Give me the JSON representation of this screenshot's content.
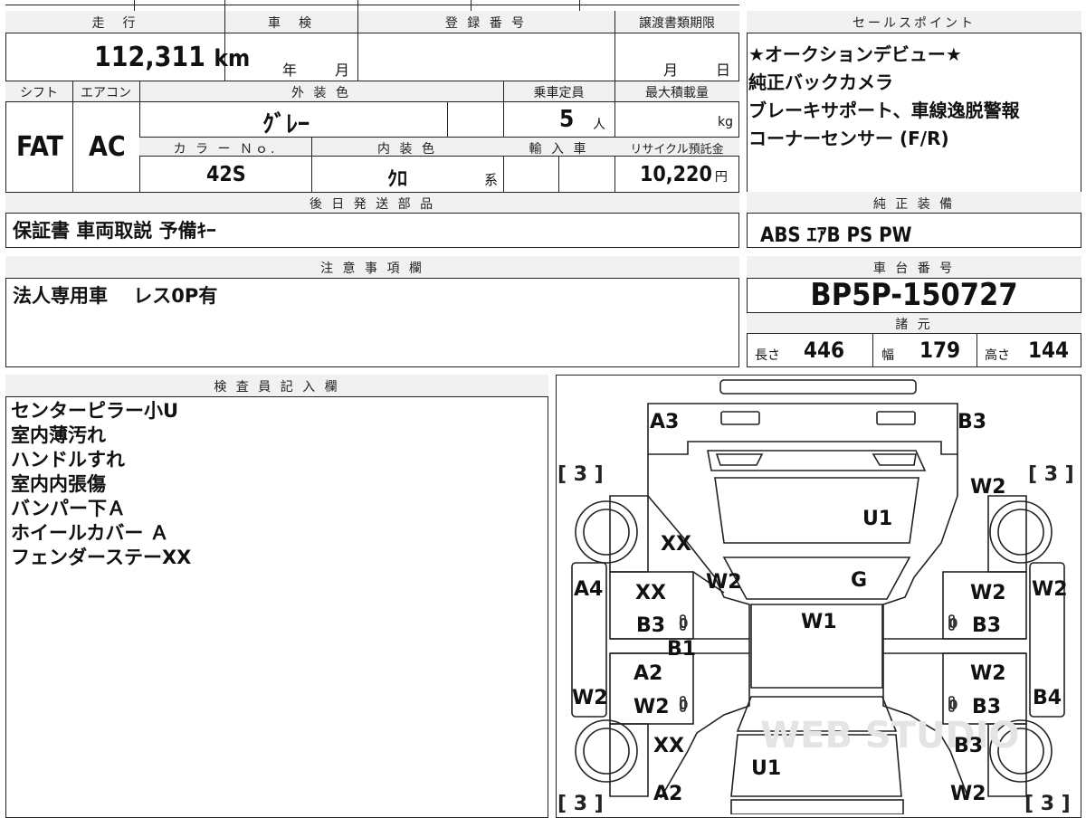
{
  "spec": {
    "mileage_label": "走　行",
    "mileage_value": "112,311",
    "mileage_unit": "km",
    "inspection_label": "車　検",
    "inspection_year": "年",
    "inspection_month": "月",
    "registration_label": "登 録 番 号",
    "registration_value": "",
    "transfer_label": "譲渡書類期限",
    "transfer_month": "月",
    "transfer_day": "日",
    "shift_label": "シフト",
    "shift_value": "FAT",
    "aircon_label": "エアコン",
    "aircon_value": "AC",
    "exterior_color_label": "外 装 色",
    "exterior_color_value": "ｸﾞﾚｰ",
    "capacity_label": "乗車定員",
    "capacity_value": "5",
    "capacity_unit": "人",
    "max_load_label": "最大積載量",
    "max_load_unit": "kg",
    "color_no_label": "カ ラ ー Ｎｏ.",
    "color_no_value": "42S",
    "interior_color_label": "内 装 色",
    "interior_color_value": "ｸﾛ",
    "interior_color_suffix": "系",
    "import_label": "輸 入 車",
    "recycle_label": "リサイクル預託金",
    "recycle_value": "10,220",
    "recycle_unit": "円"
  },
  "later_parts": {
    "label": "後 日 発 送 部 品",
    "value": "保証書 車両取説 予備ｷｰ"
  },
  "sales_points": {
    "label": "セールスポイント",
    "lines": [
      "★オークションデビュー★",
      "純正バックカメラ",
      "ブレーキサポート、車線逸脱警報",
      "コーナーセンサー (F/R)"
    ]
  },
  "standard_equipment": {
    "label": "純 正 装 備",
    "value": "ABS ｴｱB PS PW"
  },
  "notes": {
    "label": "注 意 事 項 欄",
    "value": "法人専用車　 レス0P有"
  },
  "chassis": {
    "label": "車 台 番 号",
    "value": "BP5P-150727"
  },
  "dimensions": {
    "label": "諸 元",
    "length_label": "長さ",
    "length_value": "446",
    "width_label": "幅",
    "width_value": "179",
    "height_label": "高さ",
    "height_value": "144"
  },
  "inspector": {
    "label": "検 査 員 記 入 欄",
    "lines": [
      "センターピラー小U",
      "室内薄汚れ",
      "ハンドルすれ",
      "室内内張傷",
      "バンパー下Ａ",
      "ホイールカバー Ａ",
      "フェンダーステーXX"
    ]
  },
  "diagram": {
    "marks": [
      "A3",
      "B3",
      "U1",
      "XX",
      "W2",
      "G",
      "W1",
      "W2",
      "W2",
      "A4",
      "XX",
      "B3",
      "B1",
      "B3",
      "W2",
      "A2",
      "W2",
      "W2",
      "W2",
      "B3",
      "B4",
      "XX",
      "U1",
      "B3",
      "A2",
      "W2"
    ],
    "tire_left_top": "[ 3 ]",
    "tire_right_top": "[ 3 ]",
    "tire_left_bottom": "[ 3 ]",
    "tire_right_bottom": "[ 3 ]",
    "zero_marks": [
      "0",
      "0",
      "0",
      "0"
    ],
    "watermark": "WEB STUDIO"
  }
}
